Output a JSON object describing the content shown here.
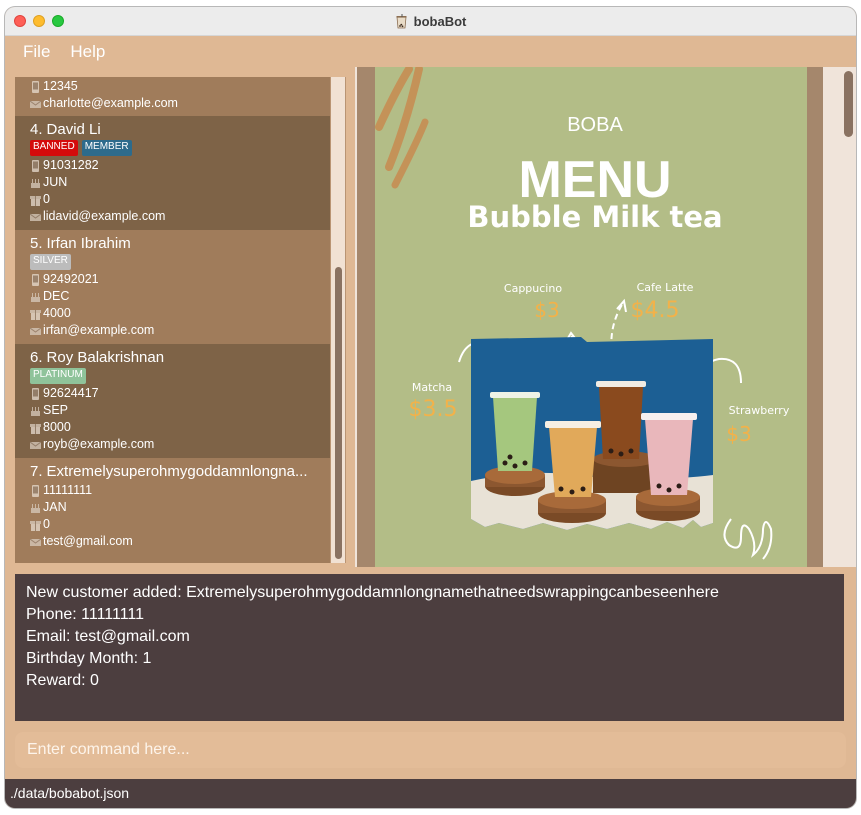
{
  "window": {
    "title": "bobaBot"
  },
  "menu": {
    "file": "File",
    "help": "Help"
  },
  "customers": [
    {
      "phone": "12345",
      "email": "charlotte@example.com"
    },
    {
      "index": "4.",
      "name": "David Li",
      "tags": [
        {
          "label": "BANNED",
          "color": "#d40b0b"
        },
        {
          "label": "MEMBER",
          "color": "#2d6b8c"
        }
      ],
      "phone": "91031282",
      "birthday": "JUN",
      "reward": "0",
      "email": "lidavid@example.com"
    },
    {
      "index": "5.",
      "name": "Irfan Ibrahim",
      "tags": [
        {
          "label": "SILVER",
          "color": "#bcbcbc"
        }
      ],
      "phone": "92492021",
      "birthday": "DEC",
      "reward": "4000",
      "email": "irfan@example.com"
    },
    {
      "index": "6.",
      "name": "Roy Balakrishnan",
      "tags": [
        {
          "label": "PLATINUM",
          "color": "#8fc39a"
        }
      ],
      "phone": "92624417",
      "birthday": "SEP",
      "reward": "8000",
      "email": "royb@example.com"
    },
    {
      "index": "7.",
      "name": "Extremelysuperohmygoddamnlongna...",
      "tags": [],
      "phone": "11111111",
      "birthday": "JAN",
      "reward": "0",
      "email": "test@gmail.com"
    }
  ],
  "poster": {
    "boba": "BOBA",
    "menu": "MENU",
    "subtitle": "Bubble Milk tea",
    "items": [
      {
        "name": "Cappucino",
        "price": "$3"
      },
      {
        "name": "Cafe Latte",
        "price": "$4.5"
      },
      {
        "name": "Matcha",
        "price": "$3.5"
      },
      {
        "name": "Strawberry",
        "price": "$3"
      }
    ],
    "colors": {
      "background": "#b3bd87",
      "price": "#f2b24a",
      "photo_bg": "#1c5f94"
    }
  },
  "result": {
    "lines": [
      "New customer added: Extremelysuperohmygoddamnlongnamethatneedswrappingcanbeseenhere",
      "Phone: 11111111",
      "Email: test@gmail.com",
      "Birthday Month: 1",
      "Reward: 0"
    ]
  },
  "command": {
    "placeholder": "Enter command here..."
  },
  "status": {
    "path": "./data/bobabot.json"
  }
}
